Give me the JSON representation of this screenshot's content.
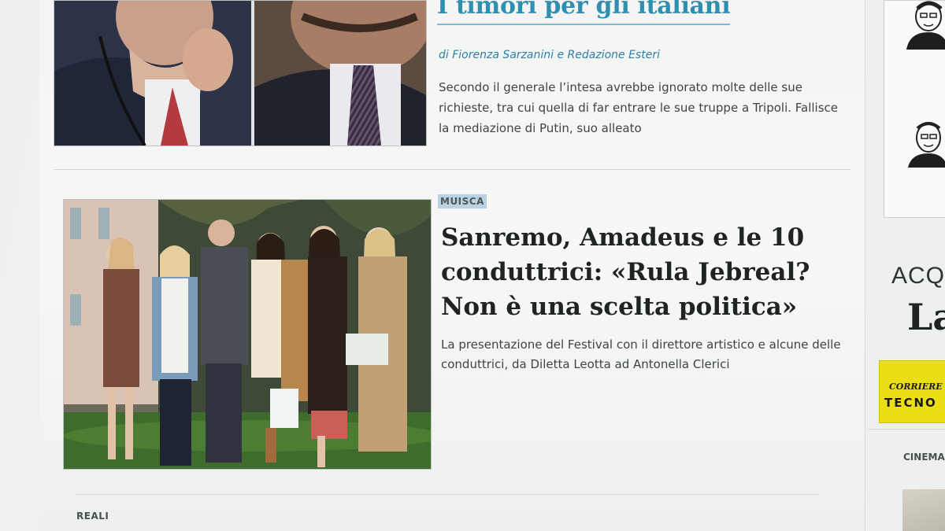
{
  "top_story": {
    "title": "I timori per gli italiani",
    "byline": "di Fiorenza Sarzanini e Redazione Esteri",
    "summary": "Secondo il generale l’intesa avrebbe ignorato molte delle sue richieste, tra cui quella di far entrare le sue truppe a Tripoli. Fallisce la mediazione di Putin, suo alleato"
  },
  "second_story": {
    "section": "MUISCA",
    "title": "Sanremo, Amadeus e le 10 conduttrici: «Rula Jebreal? Non è una scelta politica»",
    "summary": "La presentazione del Festival con il direttore artistico e alcune delle conduttrici, da Diletta Leotta ad Antonella Clerici"
  },
  "next_section": "REALI",
  "right_column": {
    "promo_line1": "ACQ",
    "promo_line2": "La",
    "badge_line1": "CORRIERE D",
    "badge_line2": "TECNO",
    "cinema_label": "CINEMA"
  },
  "colors": {
    "title_link": "#2f8fb0",
    "byline": "#2e7fa8",
    "section_tag_bg": "#b9d3e4",
    "badge_yellow": "#ecde15"
  }
}
